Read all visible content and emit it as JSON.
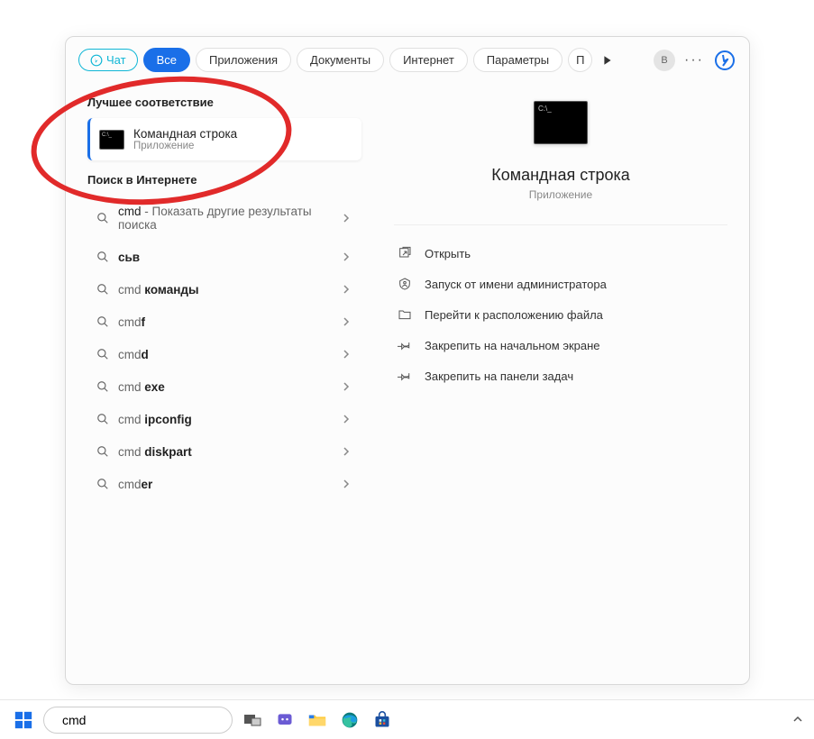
{
  "panel": {
    "chat_label": "Чат",
    "tabs": [
      "Все",
      "Приложения",
      "Документы",
      "Интернет",
      "Параметры"
    ],
    "truncated_tab": "П",
    "avatar_letter": "В"
  },
  "left": {
    "best_match_header": "Лучшее соответствие",
    "best_match": {
      "title": "Командная строка",
      "subtitle": "Приложение"
    },
    "web_header": "Поиск в Интернете",
    "suggestions": [
      {
        "prefix": "cmd",
        "suffix": " - Показать другие результаты поиска",
        "sub": ""
      },
      {
        "prefix": "",
        "bold": "сьв",
        "suffix": "",
        "sub": ""
      },
      {
        "prefix": "cmd ",
        "bold": "команды",
        "suffix": "",
        "sub": ""
      },
      {
        "prefix": "cmd",
        "bold": "f",
        "suffix": "",
        "sub": ""
      },
      {
        "prefix": "cmd",
        "bold": "d",
        "suffix": "",
        "sub": ""
      },
      {
        "prefix": "cmd ",
        "bold": "exe",
        "suffix": "",
        "sub": ""
      },
      {
        "prefix": "cmd ",
        "bold": "ipconfig",
        "suffix": "",
        "sub": ""
      },
      {
        "prefix": "cmd ",
        "bold": "diskpart",
        "suffix": "",
        "sub": ""
      },
      {
        "prefix": "cmd",
        "bold": "er",
        "suffix": "",
        "sub": ""
      }
    ]
  },
  "right": {
    "title": "Командная строка",
    "subtitle": "Приложение",
    "actions": [
      "Открыть",
      "Запуск от имени администратора",
      "Перейти к расположению файла",
      "Закрепить на начальном экране",
      "Закрепить на панели задач"
    ]
  },
  "taskbar": {
    "search_value": "cmd"
  }
}
